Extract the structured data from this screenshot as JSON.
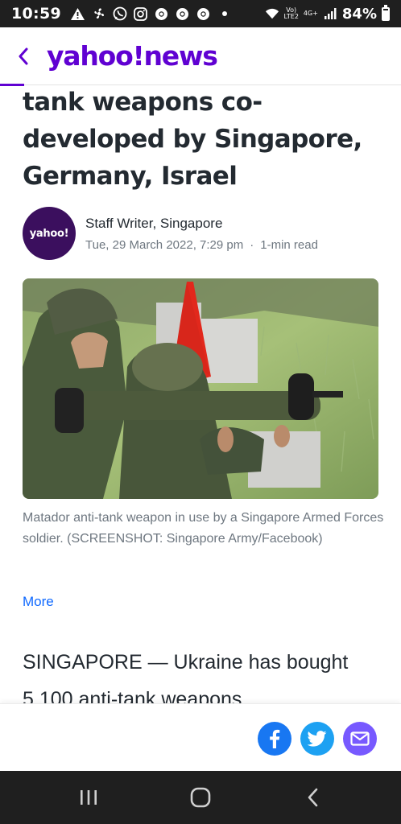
{
  "status_bar": {
    "time": "10:59",
    "volte": "Vo)",
    "lte": "LTE2",
    "network": "4G+",
    "battery": "84%",
    "icons": [
      "warning-icon",
      "fan-icon",
      "whatsapp-icon",
      "instagram-icon",
      "chrome-icon",
      "chrome-icon",
      "chrome-icon",
      "dot-icon",
      "wifi-icon",
      "signal-icon",
      "battery-icon"
    ]
  },
  "header": {
    "brand": "yahoo!",
    "section": "news",
    "brand_color": "#6001d2",
    "read_progress": 0.06
  },
  "article": {
    "headline": "tank weapons co-developed by Singapore, Germany, Israel",
    "author": "Staff Writer, Singapore",
    "avatar_text": "yahoo!",
    "date": "Tue, 29 March 2022, 7:29 pm",
    "separator": "·",
    "read_time": "1-min read",
    "caption": "Matador anti-tank weapon in use by a Singapore Armed Forces soldier. (SCREENSHOT: Singapore Army/Facebook)",
    "more": "More",
    "body": "SINGAPORE — Ukraine has bought 5,100 anti-tank weapons"
  },
  "share": {
    "facebook_color": "#1877f2",
    "twitter_color": "#1da1f2",
    "mail_color": "#7759ff"
  },
  "nav": [
    "recent-apps-icon",
    "home-icon",
    "back-icon"
  ]
}
